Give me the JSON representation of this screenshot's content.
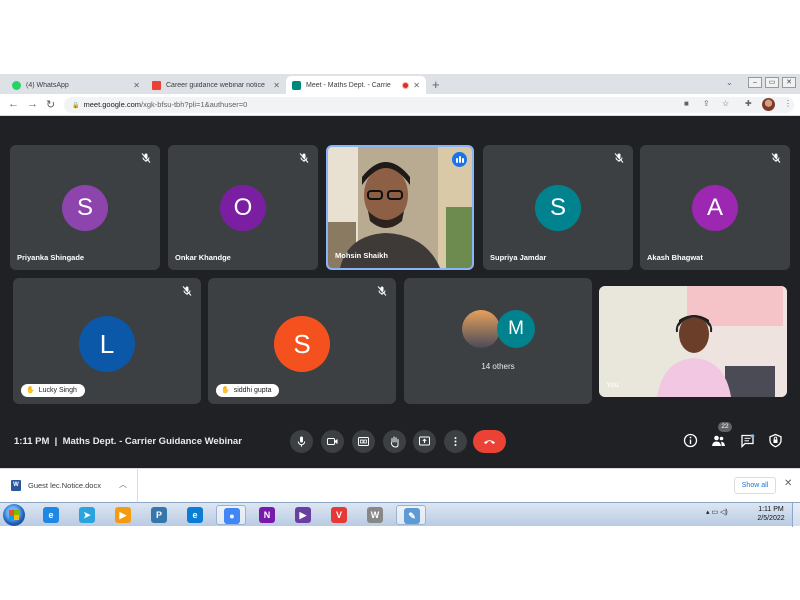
{
  "browser": {
    "tabs": [
      {
        "title": "(4) WhatsApp",
        "favicon": "whatsapp-icon",
        "color": "#25d366"
      },
      {
        "title": "Career guidance webinar notice",
        "favicon": "gmail-icon",
        "color": "#ea4335"
      },
      {
        "title": "Meet - Maths Dept. - Carrie",
        "favicon": "meet-icon",
        "color": "#00897b"
      }
    ],
    "url_host": "meet.google.com",
    "url_path": "/xgk-bfsu-tbh?pli=1&authuser=0"
  },
  "meet": {
    "participants_row1": [
      {
        "name": "Priyanka Shingade",
        "initial": "S",
        "color": "#8e44ad"
      },
      {
        "name": "Onkar Khandge",
        "initial": "O",
        "color": "#7b1fa2"
      },
      {
        "name": "Mohsin Shaikh",
        "initial": "",
        "color": "#5a4a3c"
      },
      {
        "name": "Supriya Jamdar",
        "initial": "S",
        "color": "#00838f"
      },
      {
        "name": "Akash Bhagwat",
        "initial": "A",
        "color": "#9c27b0"
      }
    ],
    "participants_row2": [
      {
        "name": "Lucky Singh",
        "initial": "L",
        "color": "#0b57a8"
      },
      {
        "name": "siddhi gupta",
        "initial": "S",
        "color": "#f4511e"
      }
    ],
    "others": {
      "label": "14 others",
      "initial": "M",
      "color": "#00838f"
    },
    "self_label": "You",
    "time": "1:11 PM",
    "meeting_title": "Maths Dept. - Carrier Guidance Webinar",
    "participant_count": "22"
  },
  "downloads": {
    "file_name": "Guest lec.Notice.docx",
    "show_all": "Show all"
  },
  "taskbar": {
    "time": "1:11 PM",
    "date": "2/5/2022",
    "apps": [
      {
        "icon": "ie-icon",
        "color": "#1e88e5",
        "glyph": "e"
      },
      {
        "icon": "telegram-icon",
        "color": "#2aa3de",
        "glyph": "➤"
      },
      {
        "icon": "media-player-icon",
        "color": "#f39c12",
        "glyph": "▶"
      },
      {
        "icon": "python-icon",
        "color": "#3776ab",
        "glyph": "P"
      },
      {
        "icon": "edge-icon",
        "color": "#0c7cd5",
        "glyph": "e"
      },
      {
        "icon": "chrome-icon",
        "color": "#4285f4",
        "glyph": "●"
      },
      {
        "icon": "onenote-icon",
        "color": "#7719aa",
        "glyph": "N"
      },
      {
        "icon": "stream-icon",
        "color": "#6b3fa0",
        "glyph": "▶"
      },
      {
        "icon": "v-app-icon",
        "color": "#e53935",
        "glyph": "V"
      },
      {
        "icon": "wordpress-icon",
        "color": "#888888",
        "glyph": "W"
      },
      {
        "icon": "paint-icon",
        "color": "#5c9bd6",
        "glyph": "✎"
      }
    ]
  }
}
